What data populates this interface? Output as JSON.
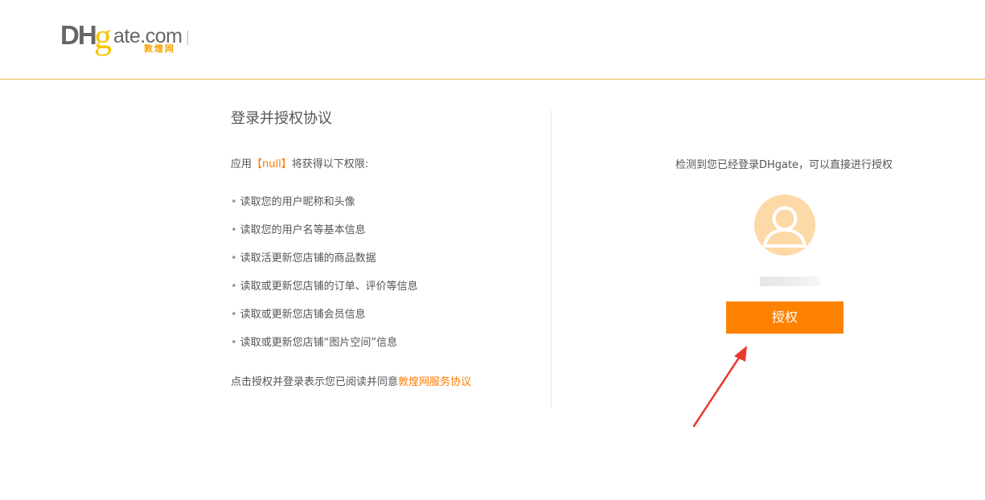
{
  "header": {
    "logo": {
      "dh": "DH",
      "g": "g",
      "ate": "ate.com",
      "cn": "敦煌网"
    }
  },
  "left": {
    "title": "登录并授权协议",
    "intro_prefix": "应用",
    "app_name": "【null】",
    "intro_suffix": "将获得以下权限:",
    "permissions": [
      "读取您的用户昵称和头像",
      "读取您的用户名等基本信息",
      "读取活更新您店铺的商品数据",
      "读取或更新您店铺的订单、评价等信息",
      "读取或更新您店铺会员信息",
      "读取或更新您店铺“图片空间”信息"
    ],
    "agree_prefix": "点击授权并登录表示您已阅读并同意",
    "agree_link": "敦煌网服务协议"
  },
  "right": {
    "detect_text": "检测到您已经登录DHgate，可以直接进行授权",
    "authorize_label": "授权"
  },
  "colors": {
    "accent": "#ff8100",
    "link": "#ff7a00",
    "avatar_bg": "#fcd9a6",
    "header_border": "#f0c24a",
    "arrow": "#e83a2e"
  },
  "icons": {
    "avatar": "user-avatar-icon",
    "arrow": "red-pointer-arrow"
  }
}
